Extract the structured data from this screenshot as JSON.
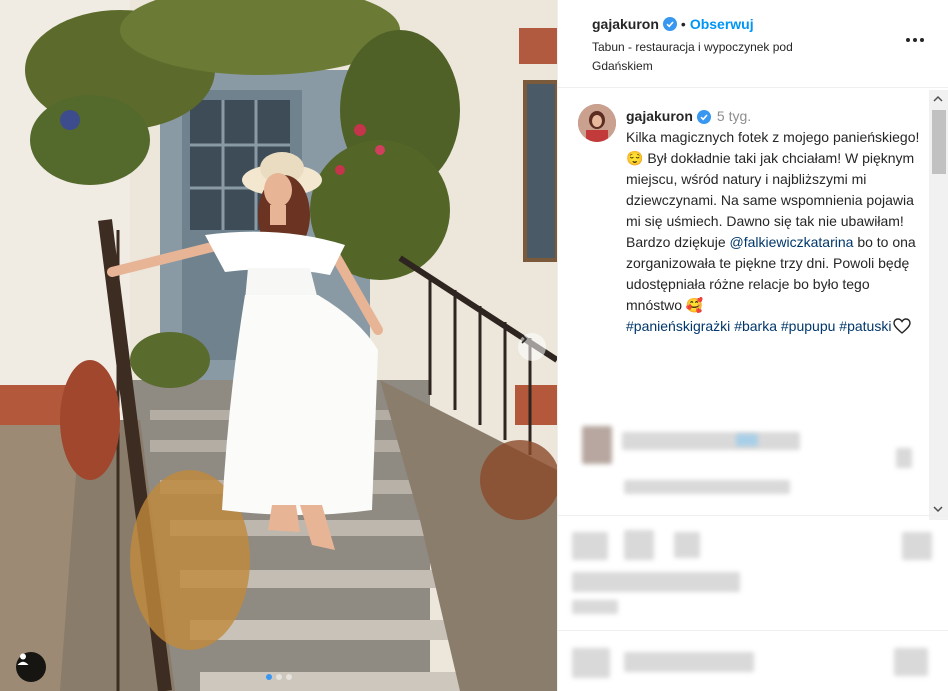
{
  "post": {
    "username": "gajakuron",
    "follow_label": "Obserwuj",
    "separator": "•",
    "location": "Tabun - restauracja i wypoczynek pod Gdańskiem"
  },
  "comment": {
    "username": "gajakuron",
    "age": "5 tyg.",
    "caption_1": "Kilka magicznych fotek z mojego panieńskiego!",
    "emoji_1": "😌",
    "caption_2": " Był dokładnie taki jak chciałam! W pięknym miejscu, wśród natury i najbliższymi mi dziewczynami. Na same wspomnienia pojawia mi się uśmiech. Dawno się tak nie ubawiłam! Bardzo dziękuje ",
    "mention": "@falkiewiczkatarina",
    "caption_3": " bo to ona zorganizowała te piękne trzy dni. Powoli będę udostępniała różne relacje bo było tego mnóstwo ",
    "emoji_2": "🥰",
    "hashtags": [
      "#panieńskigrażki",
      "#barka",
      "#pupupu",
      "#patuski"
    ]
  },
  "colors": {
    "accent": "#0095f6",
    "verified": "#3897f0",
    "hashtag": "#00376b",
    "muted": "#8e8e8e"
  },
  "icons": {
    "verified": "verified-badge-icon",
    "more": "more-options-icon",
    "next": "chevron-right-icon",
    "user_tag": "user-tag-icon",
    "heart": "heart-outline-icon"
  }
}
